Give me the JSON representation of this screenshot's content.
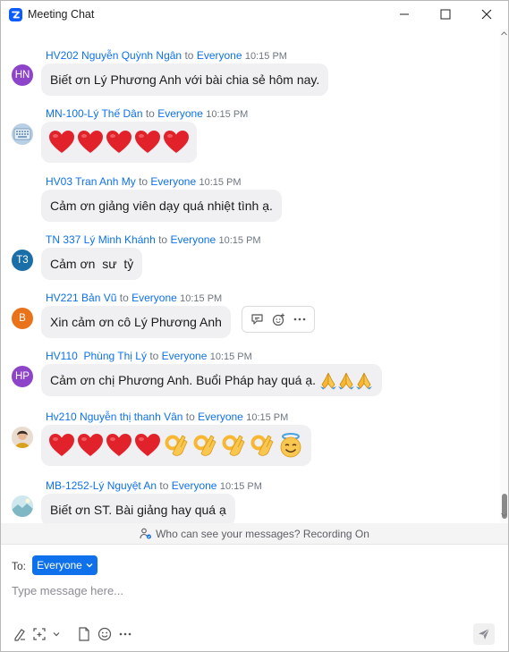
{
  "window": {
    "title": "Meeting Chat"
  },
  "messages": [
    {
      "avatar_text": "HN",
      "avatar_color": "#8e44c8",
      "sender": "HV202 Nguyễn Quỳnh Ngân",
      "to": "to",
      "recipient": "Everyone",
      "time": "10:15 PM",
      "text": "Biết ơn Lý Phương Anh với bài chia sẻ hôm nay."
    },
    {
      "avatar_text": "",
      "avatar_icon": "keyboard-photo",
      "sender": "MN-100-Lý Thế Dân",
      "to": "to",
      "recipient": "Everyone",
      "time": "10:15 PM",
      "emoji": [
        "heart",
        "heart",
        "heart",
        "heart",
        "heart"
      ]
    },
    {
      "sender": "HV03 Tran Anh My",
      "to": "to",
      "recipient": "Everyone",
      "time": "10:15 PM",
      "text": "Cảm ơn giảng viên dạy quá nhiệt tình ạ."
    },
    {
      "avatar_text": "T3",
      "avatar_color": "#1b6fa8",
      "sender": "TN 337 Lý Minh Khánh",
      "to": "to",
      "recipient": "Everyone",
      "time": "10:15 PM",
      "text": "Cảm ơn  sư  tỷ"
    },
    {
      "avatar_text": "B",
      "avatar_color": "#e8731a",
      "sender": "HV221 Bản Vũ",
      "to": "to",
      "recipient": "Everyone",
      "time": "10:15 PM",
      "text": "Xin cảm ơn cô Lý Phương Anh"
    },
    {
      "avatar_text": "HP",
      "avatar_color": "#8e44c8",
      "sender": "HV110  Phùng Thị Lý",
      "to": "to",
      "recipient": "Everyone",
      "time": "10:15 PM",
      "text": "Cảm ơn chị Phương Anh. Buổi Pháp hay quá ạ.",
      "emoji": [
        "folded-hands",
        "folded-hands",
        "folded-hands"
      ]
    },
    {
      "avatar_text": "",
      "avatar_icon": "profile-photo",
      "sender": "Hv210 Nguyễn thị thanh Vân",
      "to": "to",
      "recipient": "Everyone",
      "time": "10:15 PM",
      "emoji": [
        "heart",
        "heart",
        "heart",
        "heart",
        "ok-hand",
        "ok-hand",
        "ok-hand",
        "ok-hand",
        "smiling-face-with-halo"
      ]
    },
    {
      "avatar_text": "",
      "avatar_icon": "landscape-photo",
      "sender": "MB-1252-Lý Nguyệt An",
      "to": "to",
      "recipient": "Everyone",
      "time": "10:15 PM",
      "text": "Biết ơn ST. Bài giảng hay quá ạ"
    }
  ],
  "privacy_notice": "Who can see your messages? Recording On",
  "compose": {
    "to_label": "To:",
    "recipient": "Everyone",
    "placeholder": "Type message here..."
  },
  "colors": {
    "accent": "#0e71eb",
    "bubble": "#f0f0f2",
    "heart": "#e1222b",
    "ok_hand": "#f7b733"
  }
}
